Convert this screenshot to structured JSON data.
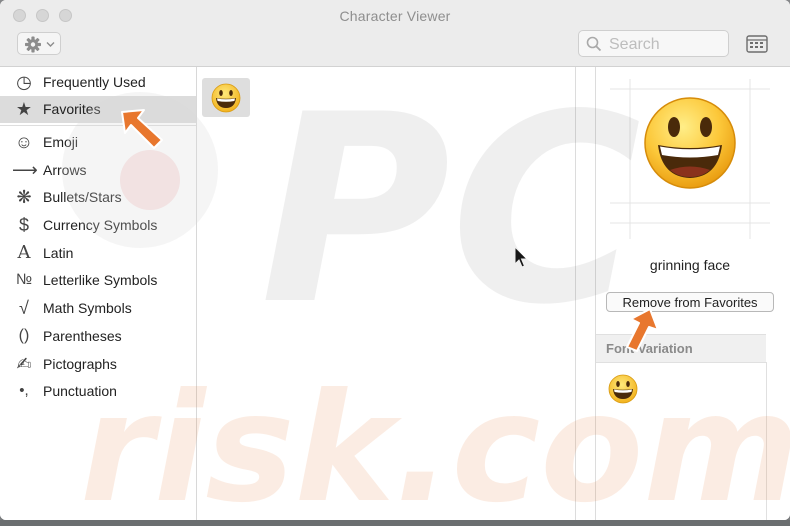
{
  "window": {
    "title": "Character Viewer"
  },
  "toolbar": {
    "action_icon": "gear-icon",
    "search_placeholder": "Search",
    "keyboard_viewer_icon": "keyboard-viewer-icon"
  },
  "sidebar": {
    "items": [
      {
        "label": "Frequently Used",
        "icon": "clock-icon",
        "glyph": "◷",
        "selected": false
      },
      {
        "label": "Favorites",
        "icon": "star-icon",
        "glyph": "★",
        "selected": true
      },
      {
        "label": "Emoji",
        "icon": "smiley-icon",
        "glyph": "☺",
        "selected": false
      },
      {
        "label": "Arrows",
        "icon": "arrow-icon",
        "glyph": "⟶",
        "selected": false
      },
      {
        "label": "Bullets/Stars",
        "icon": "asterisk-icon",
        "glyph": "❋",
        "selected": false
      },
      {
        "label": "Currency Symbols",
        "icon": "dollar-icon",
        "glyph": "$",
        "selected": false
      },
      {
        "label": "Latin",
        "icon": "latin-a-icon",
        "glyph": "A",
        "selected": false
      },
      {
        "label": "Letterlike Symbols",
        "icon": "numero-icon",
        "glyph": "№",
        "selected": false
      },
      {
        "label": "Math Symbols",
        "icon": "square-root-icon",
        "glyph": "√",
        "selected": false
      },
      {
        "label": "Parentheses",
        "icon": "parentheses-icon",
        "glyph": "()",
        "selected": false
      },
      {
        "label": "Pictographs",
        "icon": "pictograph-icon",
        "glyph": "✍",
        "selected": false
      },
      {
        "label": "Punctuation",
        "icon": "punctuation-icon",
        "glyph": "•,",
        "selected": false
      }
    ]
  },
  "favorites": [
    {
      "glyph": "😀",
      "name": "grinning face"
    }
  ],
  "detail": {
    "name": "grinning face",
    "remove_button": "Remove from Favorites",
    "font_variation_header": "Font Variation"
  },
  "watermark": {
    "text_line1": "PC",
    "text_line2": "risk.com"
  },
  "colors": {
    "annotation_arrow": "#e8772e",
    "selection": "#dcdcdc"
  }
}
